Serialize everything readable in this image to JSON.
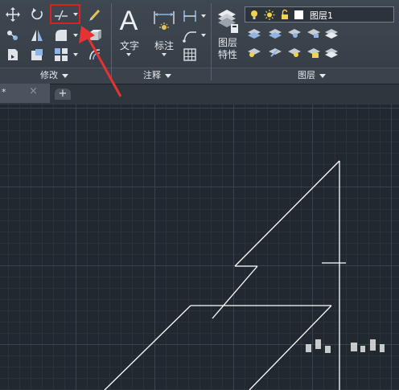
{
  "ribbon": {
    "panels": {
      "modify": {
        "title": "修改"
      },
      "annotation": {
        "title": "注释"
      },
      "layers": {
        "title": "图层"
      }
    },
    "tools": {
      "text_label": "文字",
      "dimension_label": "标注",
      "layer_props_line1": "图层",
      "layer_props_line2": "特性",
      "text_big_glyph": "A"
    },
    "layer_combo": {
      "value": "图层1"
    }
  },
  "tabs": {
    "active": {
      "label": "*"
    }
  },
  "colors": {
    "highlight": "#e11d1d",
    "annotation_arrow": "#e63232",
    "drawing_lines": "#ffffff"
  }
}
